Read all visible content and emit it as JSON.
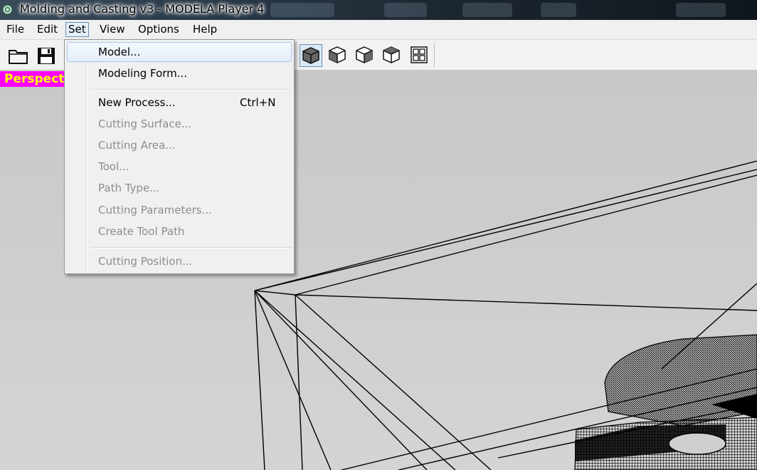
{
  "window": {
    "title": "Molding and Casting v3 - MODELA Player 4",
    "icon": "modela-app-icon"
  },
  "menubar": {
    "items": [
      {
        "label": "File"
      },
      {
        "label": "Edit"
      },
      {
        "label": "Set"
      },
      {
        "label": "View"
      },
      {
        "label": "Options"
      },
      {
        "label": "Help"
      }
    ],
    "active": "Set"
  },
  "toolbar": {
    "buttons": [
      {
        "name": "open-folder-icon"
      },
      {
        "name": "save-disk-icon"
      },
      {
        "name": "view-perspective-cube-icon",
        "pressed": true
      },
      {
        "name": "view-front-cube-icon"
      },
      {
        "name": "view-right-cube-icon"
      },
      {
        "name": "view-left-cube-icon"
      },
      {
        "name": "view-quad-layout-icon"
      }
    ]
  },
  "viewport": {
    "view_label": "Perspecti",
    "label_bg": "#ff00ff",
    "label_fg": "#ffff00"
  },
  "set_menu": {
    "items": [
      {
        "label": "Model...",
        "enabled": true,
        "highlighted": true
      },
      {
        "label": "Modeling Form...",
        "enabled": true
      },
      {
        "label": "New Process...",
        "enabled": true,
        "shortcut": "Ctrl+N"
      },
      {
        "label": "Cutting Surface...",
        "enabled": false
      },
      {
        "label": "Cutting Area...",
        "enabled": false
      },
      {
        "label": "Tool...",
        "enabled": false
      },
      {
        "label": "Path Type...",
        "enabled": false
      },
      {
        "label": "Cutting Parameters...",
        "enabled": false
      },
      {
        "label": "Create Tool Path",
        "enabled": false
      },
      {
        "label": "Cutting Position...",
        "enabled": false
      }
    ]
  }
}
